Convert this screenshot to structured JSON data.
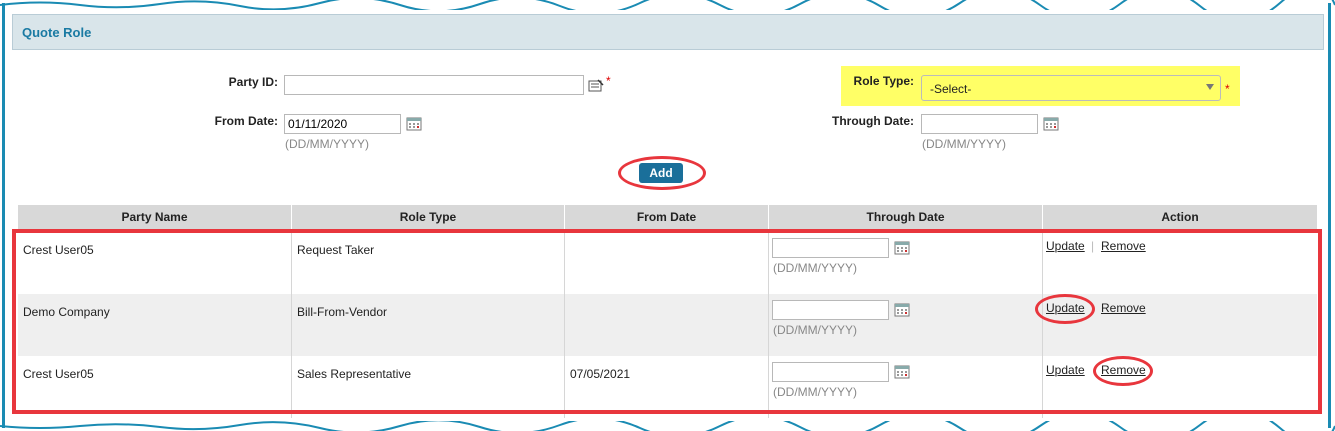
{
  "panel": {
    "title": "Quote Role"
  },
  "form": {
    "party_id_label": "Party ID:",
    "party_id_value": "",
    "required_mark": "*",
    "role_type_label": "Role Type:",
    "role_type_value": "-Select-",
    "from_date_label": "From Date:",
    "from_date_value": "01/11/2020",
    "through_date_label": "Through Date:",
    "through_date_value": "",
    "date_hint": "(DD/MM/YYYY)",
    "add_label": "Add"
  },
  "table": {
    "headers": [
      "Party Name",
      "Role Type",
      "From Date",
      "Through Date",
      "Action"
    ],
    "rows": [
      {
        "party": "Crest User05",
        "role": "Request Taker",
        "from": "",
        "through": "",
        "hint": "(DD/MM/YYYY)",
        "update": "Update",
        "remove": "Remove"
      },
      {
        "party": "Demo Company",
        "role": "Bill-From-Vendor",
        "from": "",
        "through": "",
        "hint": "(DD/MM/YYYY)",
        "update": "Update",
        "remove": "Remove"
      },
      {
        "party": "Crest User05",
        "role": "Sales Representative",
        "from": "07/05/2021",
        "through": "",
        "hint": "(DD/MM/YYYY)",
        "update": "Update",
        "remove": "Remove"
      }
    ],
    "separator": "|"
  },
  "colors": {
    "accent": "#1a8bb3",
    "annotation": "#e8363d",
    "highlight": "#ffff66",
    "button": "#1a6f9a"
  },
  "icons": [
    "lookup-icon",
    "calendar-icon",
    "dropdown-arrow-icon"
  ]
}
